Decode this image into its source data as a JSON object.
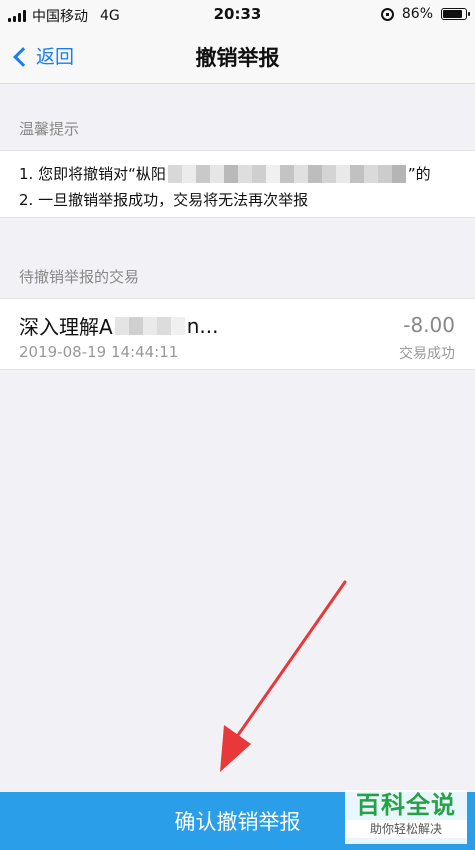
{
  "status_bar": {
    "carrier": "中国移动",
    "network": "4G",
    "time": "20:33",
    "battery": "86%",
    "battery_level": 0.86
  },
  "nav": {
    "back_label": "返回",
    "title": "撤销举报"
  },
  "notice": {
    "section_title": "温馨提示",
    "line1_prefix": "1. 您即将撤销对“枞阳",
    "line1_suffix": "”的",
    "line2": "2. 一旦撤销举报成功，交易将无法再次举报"
  },
  "pending": {
    "section_title": "待撤销举报的交易",
    "transaction": {
      "name_prefix": "深入理解A",
      "name_suffix": "n...",
      "date": "2019-08-19 14:44:11",
      "amount": "-8.00",
      "status": "交易成功"
    }
  },
  "confirm_button": {
    "label": "确认撤销举报"
  },
  "watermark": {
    "title": "百科全说",
    "subtitle": "助你轻松解决"
  },
  "colors": {
    "accent": "#1a7ef0",
    "button": "#2a9ee9",
    "arrow": "#e8383a",
    "watermark": "#25a244"
  }
}
